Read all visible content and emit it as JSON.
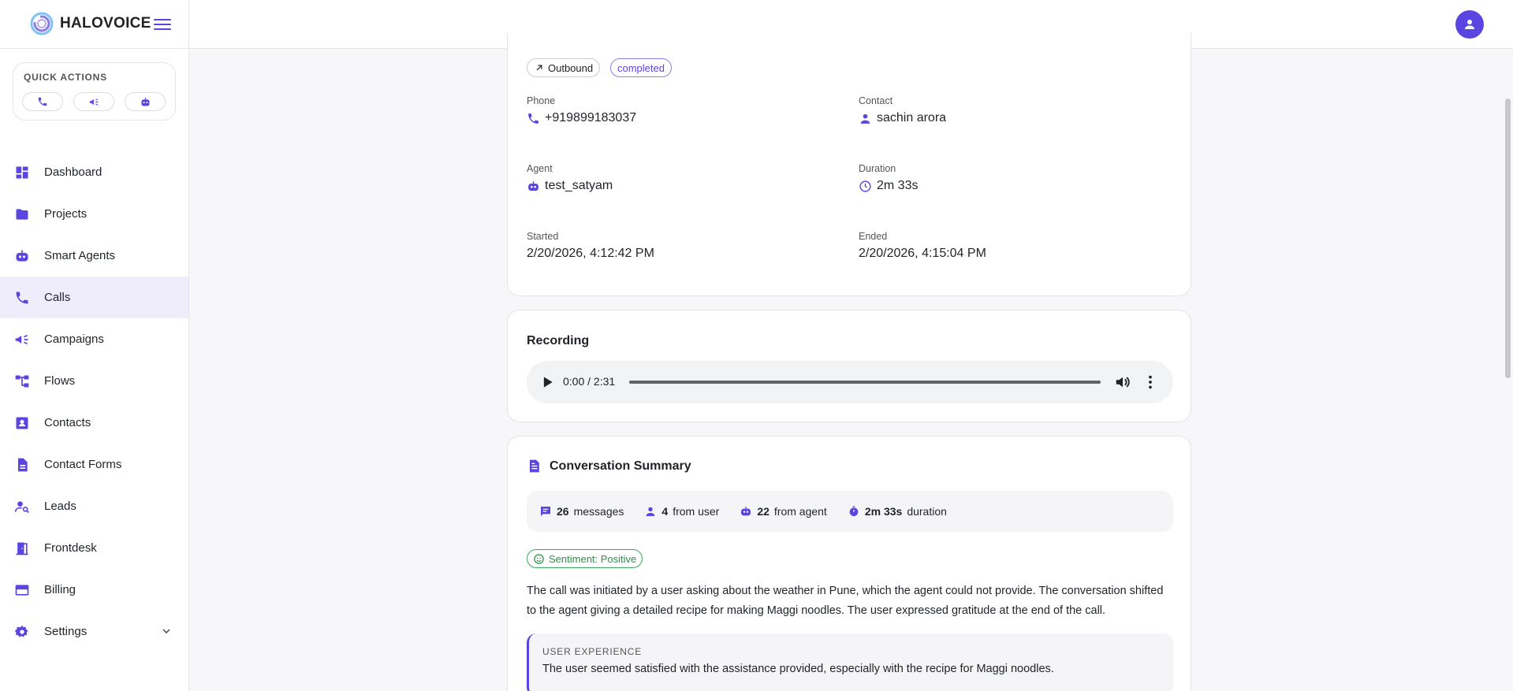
{
  "header": {
    "brand": "HALOVOICE"
  },
  "sidebar": {
    "quick_actions_title": "QUICK ACTIONS",
    "items": [
      {
        "label": "Dashboard",
        "icon": "dashboard-icon"
      },
      {
        "label": "Projects",
        "icon": "folder-icon"
      },
      {
        "label": "Smart Agents",
        "icon": "robot-icon"
      },
      {
        "label": "Calls",
        "icon": "phone-icon"
      },
      {
        "label": "Campaigns",
        "icon": "megaphone-icon"
      },
      {
        "label": "Flows",
        "icon": "flow-icon"
      },
      {
        "label": "Contacts",
        "icon": "contacts-icon"
      },
      {
        "label": "Contact Forms",
        "icon": "document-icon"
      },
      {
        "label": "Leads",
        "icon": "person-search-icon"
      },
      {
        "label": "Frontdesk",
        "icon": "door-icon"
      },
      {
        "label": "Billing",
        "icon": "credit-card-icon"
      },
      {
        "label": "Settings",
        "icon": "gear-icon"
      }
    ],
    "active": "Calls"
  },
  "details": {
    "direction": "Outbound",
    "status": "completed",
    "phone_label": "Phone",
    "phone": "+919899183037",
    "contact_label": "Contact",
    "contact": "sachin arora",
    "agent_label": "Agent",
    "agent": "test_satyam",
    "duration_label": "Duration",
    "duration": "2m 33s",
    "started_label": "Started",
    "started": "2/20/2026, 4:12:42 PM",
    "ended_label": "Ended",
    "ended": "2/20/2026, 4:15:04 PM"
  },
  "recording": {
    "title": "Recording",
    "time": "0:00 / 2:31"
  },
  "summary": {
    "title": "Conversation Summary",
    "messages_count": "26",
    "messages_label": "messages",
    "user_count": "4",
    "user_label": "from user",
    "agent_count": "22",
    "agent_label": "from agent",
    "duration_value": "2m 33s",
    "duration_label": "duration",
    "sentiment": "Sentiment: Positive",
    "text": "The call was initiated by a user asking about the weather in Pune, which the agent could not provide. The conversation shifted to the agent giving a detailed recipe for making Maggi noodles. The user expressed gratitude at the end of the call.",
    "ux_label": "USER EXPERIENCE",
    "ux_text": "The user seemed satisfied with the assistance provided, especially with the recipe for Maggi noodles."
  },
  "colors": {
    "accent": "#5b45e0",
    "active_bg": "#efedfb",
    "positive": "#2b8f47"
  }
}
